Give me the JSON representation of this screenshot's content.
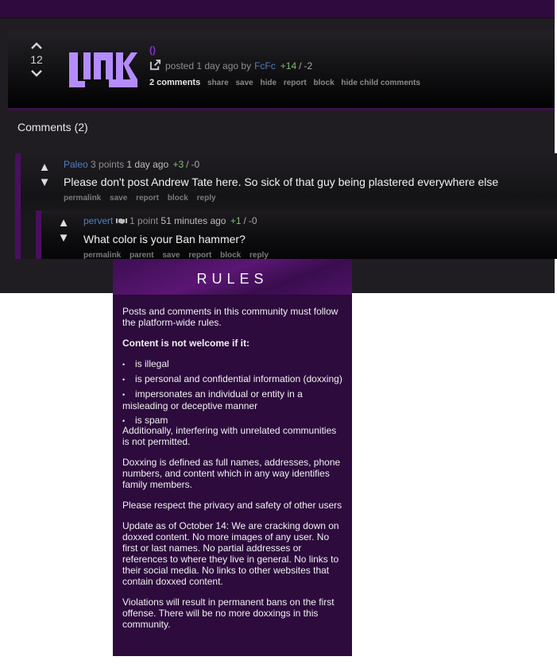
{
  "post": {
    "score": "12",
    "thumbnail_text": "LINK",
    "title": "()",
    "meta": {
      "posted_prefix": "posted 1 day ago by",
      "author": "FcFc",
      "upvotes": "+14",
      "separator": "/",
      "downvotes": "-2"
    },
    "links": {
      "comments": "2 comments",
      "share": "share",
      "save": "save",
      "hide": "hide",
      "report": "report",
      "block": "block",
      "hide_child": "hide child comments"
    }
  },
  "comments_section": {
    "title": "Comments (2)",
    "comments": [
      {
        "author": "Paleo",
        "points": "3 points",
        "time": "1 day ago",
        "upvotes": "+3",
        "separator": "/",
        "downvotes": "-0",
        "body": "Please don't post Andrew Tate here. So sick of that guy being plastered everywhere else",
        "links": [
          "permalink",
          "save",
          "report",
          "block",
          "reply"
        ]
      },
      {
        "author": "pervert",
        "badge_icon": "moderator-handshake-icon",
        "points": "1 point",
        "time": "51 minutes ago",
        "upvotes": "+1",
        "separator": "/",
        "downvotes": "-0",
        "body": "What color is your Ban hammer?",
        "links": [
          "permalink",
          "parent",
          "save",
          "report",
          "block",
          "reply"
        ]
      }
    ]
  },
  "rules": {
    "title": "RULES",
    "intro": "Posts and comments in this community must follow the platform-wide rules.",
    "list_heading": "Content is not welcome if it:",
    "items": [
      "is illegal",
      "is personal and confidential information (doxxing)",
      "impersonates an individual or entity in a misleading or deceptive manner",
      "is spam"
    ],
    "additional": "Additionally, interfering with unrelated communities is not permitted.",
    "doxxing_definition": "Doxxing is defined as full names, addresses, phone numbers, and content which in any way identifies family members.",
    "respect": "Please respect the privacy and safety of other users",
    "update": "Update as of October 14: We are cracking down on doxxed content. No more images of any user. No first or last names. No partial addresses or references to where they live in general. No links to their social media. No links to other websites that contain doxxed content.",
    "violations": "Violations will result in permanent bans on the first offense. There will be no more doxxings in this community."
  },
  "colors": {
    "accent_purple": "#4a0f60",
    "rules_bg": "#2d0b3d",
    "username_blue": "#4f7fbd",
    "upvote_green": "#7fbf6f",
    "thumbnail_lavender": "#b48cff"
  }
}
